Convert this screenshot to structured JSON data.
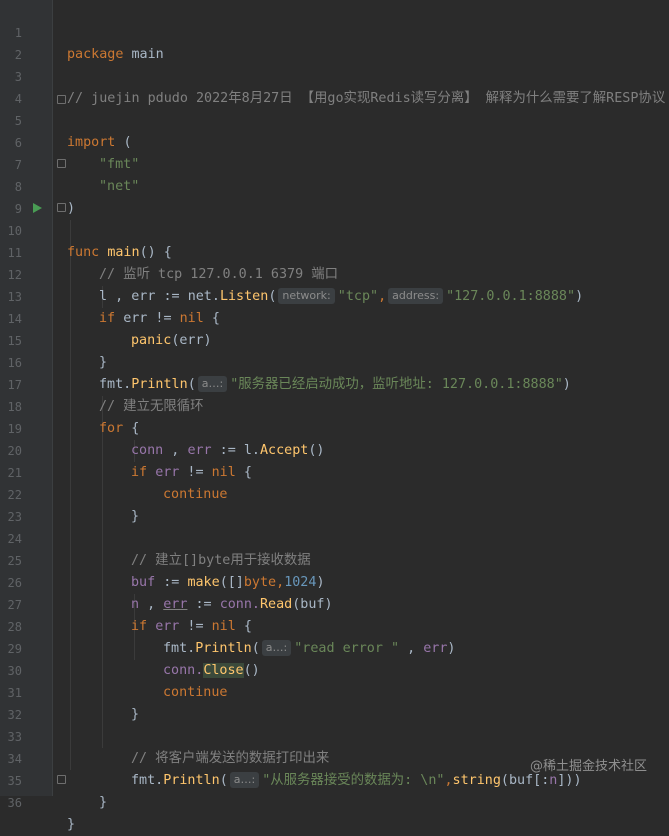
{
  "editor": {
    "lines": [
      {
        "n": "1"
      },
      {
        "n": "2"
      },
      {
        "n": "3"
      },
      {
        "n": "4"
      },
      {
        "n": "5"
      },
      {
        "n": "6"
      },
      {
        "n": "7"
      },
      {
        "n": "8"
      },
      {
        "n": "9"
      },
      {
        "n": "10"
      },
      {
        "n": "11"
      },
      {
        "n": "12"
      },
      {
        "n": "13"
      },
      {
        "n": "14"
      },
      {
        "n": "15"
      },
      {
        "n": "16"
      },
      {
        "n": "17"
      },
      {
        "n": "18"
      },
      {
        "n": "19"
      },
      {
        "n": "20"
      },
      {
        "n": "21"
      },
      {
        "n": "22"
      },
      {
        "n": "23"
      },
      {
        "n": "24"
      },
      {
        "n": "25"
      },
      {
        "n": "26"
      },
      {
        "n": "27"
      },
      {
        "n": "28"
      },
      {
        "n": "29"
      },
      {
        "n": "30"
      },
      {
        "n": "31"
      },
      {
        "n": "32"
      },
      {
        "n": "33"
      },
      {
        "n": "34"
      },
      {
        "n": "35"
      },
      {
        "n": "36"
      }
    ],
    "t": {
      "package_kw": "package",
      "main_name": "main",
      "comment3": "// juejin pdudo 2022年8月27日 【用go实现Redis读写分离】 解释为什么需要了解RESP协议",
      "import_kw": "import",
      "paren_open": "(",
      "paren_close": ")",
      "fmt_str": "\"fmt\"",
      "net_str": "\"net\"",
      "func_kw": "func",
      "main_fn": "main",
      "main_sig": "() {",
      "comment11": "// 监听 tcp 127.0.0.1 6379 端口",
      "l_var": "l",
      "comma_err": " , ",
      "err": "err",
      "assign": " := ",
      "net_pkg": "net.",
      "listen_fn": "Listen",
      "open_paren": "(",
      "hint_network": "network:",
      "tcp_str": "\"tcp\"",
      "comma": ",",
      "hint_address": "address:",
      "addr_str": "\"127.0.0.1:8888\"",
      "close_paren": ")",
      "if_kw": "if",
      "neq": " != ",
      "nil_kw": "nil",
      "brace_open": " {",
      "brace_close": "}",
      "panic_fn": "panic",
      "panic_args": "(err)",
      "fmt_pkg": "fmt.",
      "println_fn": "Println",
      "hint_a": "a…:",
      "started_str": "\"服务器已经启动成功，监听地址: 127.0.0.1:8888\"",
      "comment17": "// 建立无限循环",
      "for_kw": "for",
      "conn": "conn",
      "accept_call": "l.",
      "accept_fn": "Accept",
      "empty_call": "()",
      "continue_kw": "continue",
      "comment24": "// 建立[]byte用于接收数据",
      "buf": "buf",
      "make_fn": "make",
      "make_open": "([]",
      "byte_kw": "byte",
      "num_1024": "1024",
      "n_var": "n",
      "read_fn": "Read",
      "buf_arg": "(buf)",
      "read_err_str": "\"read error \"",
      "comma_sp": " , ",
      "conn_dot": "conn.",
      "close_fn": "Close",
      "comment33": "// 将客户端发送的数据打印出来",
      "recv_str": "\"从服务器接受的数据为: \\n\"",
      "string_fn": "string",
      "slice_open": "(buf[:",
      "slice_close": "]))"
    }
  },
  "watermark": "@稀土掘金技术社区",
  "colors": {
    "background": "#2b2b2b",
    "keyword": "#cc7832",
    "string": "#6a8759",
    "comment": "#808080",
    "number": "#6897bb",
    "function": "#ffc66d",
    "variable": "#9876aa",
    "text": "#a9b7c6"
  },
  "icons": {
    "run_gutter": "run-triangle-icon",
    "fold_markers": "fold-icon"
  }
}
